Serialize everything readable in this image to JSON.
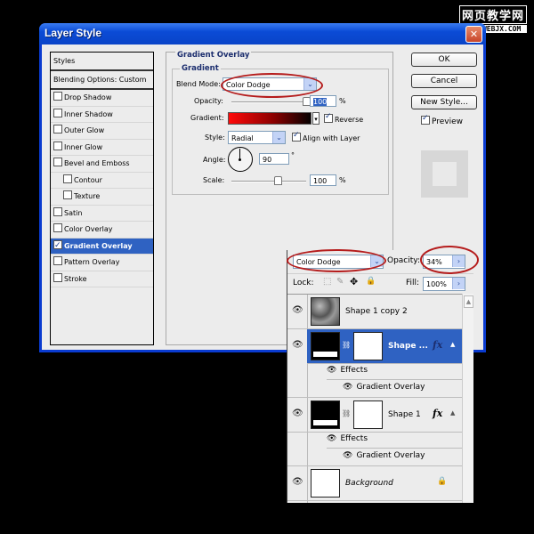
{
  "watermark": {
    "line1": "网页教学网",
    "line2": "WWW.WEBJX.COM"
  },
  "dialog": {
    "title": "Layer Style",
    "close_icon": "close-icon",
    "styles_list": {
      "header": "Styles",
      "blending": "Blending Options: Custom",
      "items": [
        {
          "label": "Drop Shadow",
          "checked": false,
          "sub": false
        },
        {
          "label": "Inner Shadow",
          "checked": false,
          "sub": false
        },
        {
          "label": "Outer Glow",
          "checked": false,
          "sub": false
        },
        {
          "label": "Inner Glow",
          "checked": false,
          "sub": false
        },
        {
          "label": "Bevel and Emboss",
          "checked": false,
          "sub": false
        },
        {
          "label": "Contour",
          "checked": false,
          "sub": true
        },
        {
          "label": "Texture",
          "checked": false,
          "sub": true
        },
        {
          "label": "Satin",
          "checked": false,
          "sub": false
        },
        {
          "label": "Color Overlay",
          "checked": false,
          "sub": false
        },
        {
          "label": "Gradient Overlay",
          "checked": true,
          "sub": false,
          "selected": true
        },
        {
          "label": "Pattern Overlay",
          "checked": false,
          "sub": false
        },
        {
          "label": "Stroke",
          "checked": false,
          "sub": false
        }
      ]
    },
    "gradient_overlay": {
      "section_title": "Gradient Overlay",
      "group_title": "Gradient",
      "blend_mode_label": "Blend Mode:",
      "blend_mode_value": "Color Dodge",
      "opacity_label": "Opacity:",
      "opacity_value": "100",
      "opacity_unit": "%",
      "gradient_label": "Gradient:",
      "gradient_colors": [
        "#ff0a0a",
        "#8a0000",
        "#050000"
      ],
      "reverse_label": "Reverse",
      "reverse_checked": true,
      "style_label": "Style:",
      "style_value": "Radial",
      "align_label": "Align with Layer",
      "align_checked": true,
      "angle_label": "Angle:",
      "angle_value": "90",
      "angle_unit": "°",
      "scale_label": "Scale:",
      "scale_value": "100",
      "scale_unit": "%"
    },
    "buttons": {
      "ok": "OK",
      "cancel": "Cancel",
      "new_style": "New Style...",
      "preview": "Preview"
    },
    "preview_checked": true
  },
  "layers_panel": {
    "blend_mode": "Color Dodge",
    "opacity_label": "Opacity:",
    "opacity_value": "34%",
    "lock_label": "Lock:",
    "fill_label": "Fill:",
    "fill_value": "100%",
    "layers": [
      {
        "name": "Shape 1 copy 2",
        "thumb": "noise",
        "selected": false
      },
      {
        "name": "Shape ...",
        "thumb": "shape",
        "selected": true,
        "fx": "fx",
        "effects_label": "Effects",
        "effect": "Gradient Overlay"
      },
      {
        "name": "Shape 1",
        "thumb": "shape",
        "selected": false,
        "fx": "fx",
        "effects_label": "Effects",
        "effect": "Gradient Overlay"
      },
      {
        "name": "Background",
        "thumb": "white",
        "selected": false,
        "locked": true
      }
    ]
  },
  "accent_colors": {
    "selection": "#2f62c2",
    "title_bar": "#0b4bd6",
    "annotation": "#b51c1c"
  }
}
